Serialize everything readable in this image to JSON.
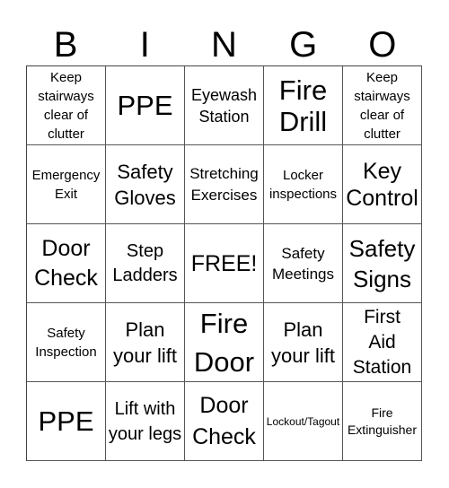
{
  "header": {
    "letters": [
      "B",
      "I",
      "N",
      "G",
      "O"
    ]
  },
  "colors": {
    "background": "#ffffff",
    "text": "#000000",
    "grid_lines": "#555555"
  },
  "cells": [
    [
      "Keep stairways clear of clutter",
      "PPE",
      "Eyewash Station",
      "Fire Drill",
      "Keep stairways clear of clutter"
    ],
    [
      "Emergency Exit",
      "Safety Gloves",
      "Stretching Exercises",
      "Locker inspections",
      "Key Control"
    ],
    [
      "Door Check",
      "Step Ladders",
      "FREE!",
      "Safety Meetings",
      "Safety Signs"
    ],
    [
      "Safety Inspection",
      "Plan your lift",
      "Fire Door",
      "Plan your lift",
      "First Aid Station"
    ],
    [
      "PPE",
      "Lift with your legs",
      "Door Check",
      "Lockout/Tagout",
      "Fire Extinguisher"
    ]
  ]
}
